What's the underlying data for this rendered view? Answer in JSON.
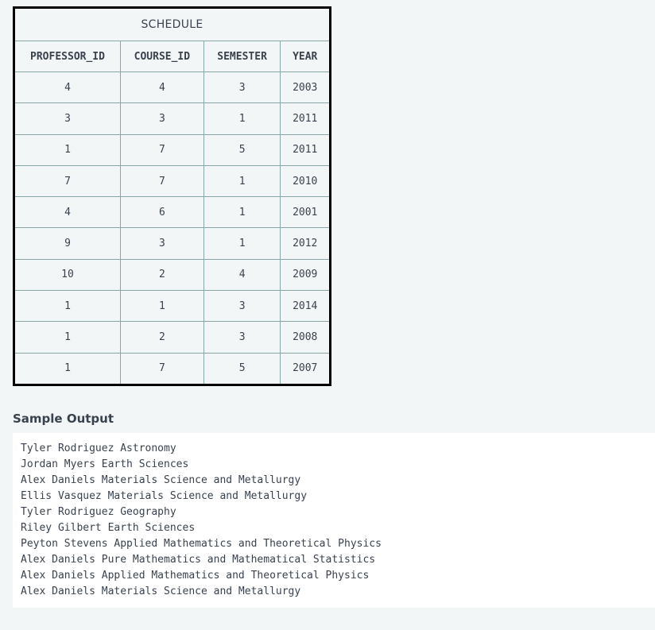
{
  "schedule": {
    "title": "SCHEDULE",
    "columns": [
      "PROFESSOR_ID",
      "COURSE_ID",
      "SEMESTER",
      "YEAR"
    ],
    "rows": [
      [
        "4",
        "4",
        "3",
        "2003"
      ],
      [
        "3",
        "3",
        "1",
        "2011"
      ],
      [
        "1",
        "7",
        "5",
        "2011"
      ],
      [
        "7",
        "7",
        "1",
        "2010"
      ],
      [
        "4",
        "6",
        "1",
        "2001"
      ],
      [
        "9",
        "3",
        "1",
        "2012"
      ],
      [
        "10",
        "2",
        "4",
        "2009"
      ],
      [
        "1",
        "1",
        "3",
        "2014"
      ],
      [
        "1",
        "2",
        "3",
        "2008"
      ],
      [
        "1",
        "7",
        "5",
        "2007"
      ]
    ]
  },
  "sample_output": {
    "title": "Sample Output",
    "lines": [
      "Tyler Rodriguez Astronomy",
      "Jordan Myers Earth Sciences",
      "Alex Daniels Materials Science and Metallurgy",
      "Ellis Vasquez Materials Science and Metallurgy",
      "Tyler Rodriguez Geography",
      "Riley Gilbert Earth Sciences",
      "Peyton Stevens Applied Mathematics and Theoretical Physics",
      "Alex Daniels Pure Mathematics and Mathematical Statistics",
      "Alex Daniels Applied Mathematics and Theoretical Physics",
      "Alex Daniels Materials Science and Metallurgy"
    ]
  }
}
